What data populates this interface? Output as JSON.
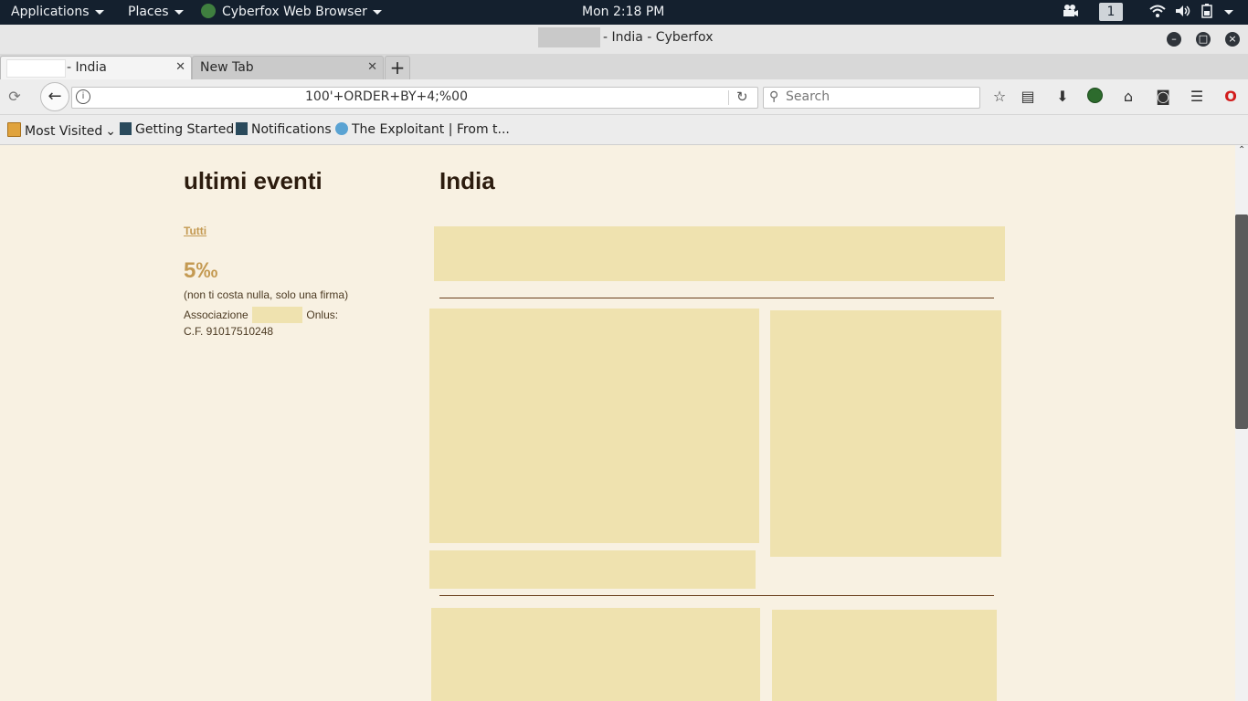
{
  "system_bar": {
    "applications": "Applications",
    "places": "Places",
    "active_app": "Cyberfox Web Browser",
    "clock": "Mon  2:18 PM",
    "workspace": "1"
  },
  "window": {
    "title": "- India - Cyberfox"
  },
  "tabs": [
    {
      "label": "- India"
    },
    {
      "label": "New Tab"
    }
  ],
  "toolbar": {
    "url_text": "100'+ORDER+BY+4;%00",
    "search_placeholder": "Search"
  },
  "bookmarks": [
    {
      "label": "Most Visited",
      "icon": "folder-icon"
    },
    {
      "label": "Getting Started",
      "icon": "bookmark-page-icon"
    },
    {
      "label": "Notifications",
      "icon": "bookmark-page-icon"
    },
    {
      "label": "The Exploitant | From t...",
      "icon": "wordpress-icon"
    }
  ],
  "page": {
    "sidebar_heading": "ultimi eventi",
    "all_link": "Tutti",
    "donation_title": "5‰",
    "donation_note": "(non ti costa nulla, solo una firma)",
    "association_prefix": "Associazione",
    "association_suffix": "Onlus:",
    "tax_code": "C.F. 91017510248",
    "main_heading": "India"
  },
  "colors": {
    "page_bg": "#f8f1e2",
    "placeholder_block": "#efe2af",
    "rule": "#6a3f1d",
    "link": "#c49a52"
  }
}
